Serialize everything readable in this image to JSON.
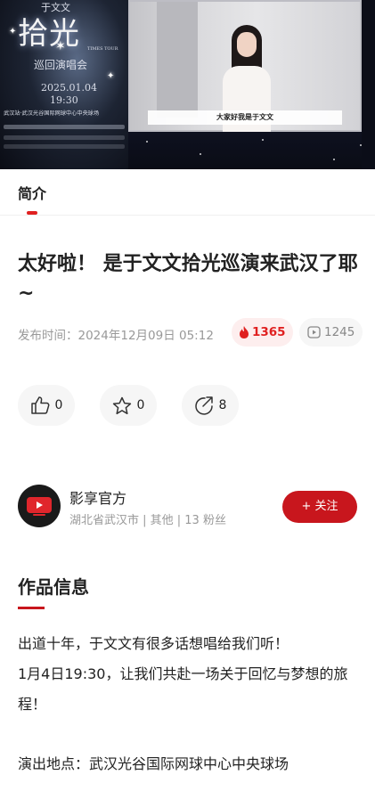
{
  "video": {
    "poster_title": "拾光",
    "poster_top_text": "于文文",
    "poster_subtitle": "巡回演唱会",
    "poster_tour": "TIMES TOUR",
    "poster_date": "2025.01.04",
    "poster_time": "19:30",
    "poster_venue": "武汉站·武汉光谷国际网球中心中央球场",
    "caption": "大家好我是于文文"
  },
  "tabs": [
    {
      "label": "简介",
      "active": true
    }
  ],
  "article": {
    "title": "太好啦！ 是于文文拾光巡演来武汉了耶~",
    "publish_label": "发布时间：2024年12月09日 05:12",
    "hot_count": "1365",
    "play_count": "1245"
  },
  "actions": {
    "like_count": "0",
    "favorite_count": "0",
    "share_count": "8"
  },
  "author": {
    "name": "影享官方",
    "meta": "湖北省武汉市 | 其他 | 13 粉丝",
    "follow_label": "+ 关注"
  },
  "works": {
    "section_title": "作品信息",
    "lines": [
      "出道十年，于文文有很多话想唱给我们听！",
      "1月4日19:30，让我们共赴一场关于回忆与梦想的旅程！"
    ],
    "venue": "演出地点：武汉光谷国际网球中心中央球场"
  },
  "colors": {
    "accent": "#c8161d",
    "hot_bg": "#fdeeee",
    "hot_text": "#e02020",
    "muted": "#999999"
  },
  "icons": [
    "flame-icon",
    "play-count-icon",
    "thumbs-up-icon",
    "star-icon",
    "share-icon",
    "play-logo-icon"
  ]
}
